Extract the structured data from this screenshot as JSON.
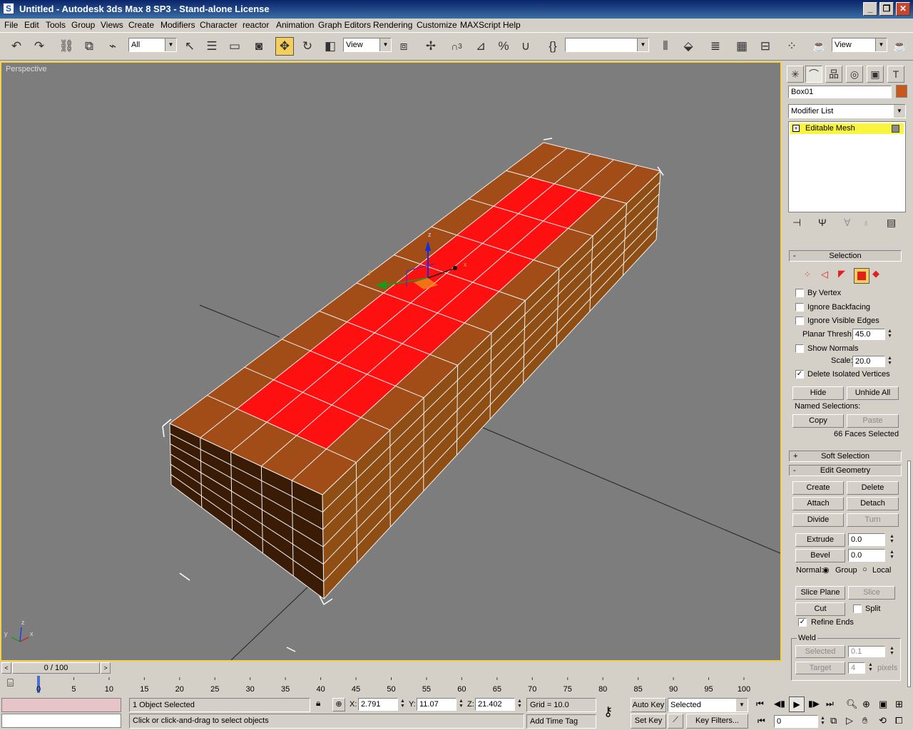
{
  "window": {
    "title": "Untitled - Autodesk 3ds Max 8 SP3  - Stand-alone License"
  },
  "menu": [
    "File",
    "Edit",
    "Tools",
    "Group",
    "Views",
    "Create",
    "Modifiers",
    "Character",
    "reactor",
    "Animation",
    "Graph Editors",
    "Rendering",
    "Customize",
    "MAXScript",
    "Help"
  ],
  "toolbar": {
    "selection_filter": "All",
    "ref_coord": "View",
    "named_sel": "",
    "render_view": "View",
    "snap_angle": "3",
    "snap_percent": "%"
  },
  "viewport": {
    "label": "Perspective",
    "gizmo_axes": {
      "x": "x",
      "y": "y",
      "z": "z"
    },
    "corner_axes": {
      "x": "x",
      "y": "y",
      "z": "z"
    }
  },
  "command_panel": {
    "object_name": "Box01",
    "object_color": "#c8571a",
    "modifier_list": "Modifier List",
    "stack_item": "Editable Mesh",
    "selection": {
      "title": "Selection",
      "by_vertex": "By Vertex",
      "ignore_backfacing": "Ignore Backfacing",
      "ignore_visible_edges": "Ignore Visible Edges",
      "planar_thresh_label": "Planar Thresh:",
      "planar_thresh": "45.0",
      "show_normals": "Show Normals",
      "scale_label": "Scale:",
      "scale": "20.0",
      "delete_isolated": "Delete Isolated Vertices",
      "hide": "Hide",
      "unhide_all": "Unhide All",
      "named_selections": "Named Selections:",
      "copy": "Copy",
      "paste": "Paste",
      "status": "66 Faces Selected"
    },
    "soft_selection": {
      "title": "Soft Selection"
    },
    "edit_geometry": {
      "title": "Edit Geometry",
      "create": "Create",
      "delete": "Delete",
      "attach": "Attach",
      "detach": "Detach",
      "divide": "Divide",
      "turn": "Turn",
      "extrude": "Extrude",
      "extrude_val": "0.0",
      "bevel": "Bevel",
      "bevel_val": "0.0",
      "normal_label": "Normal:",
      "group": "Group",
      "local": "Local",
      "slice_plane": "Slice Plane",
      "slice": "Slice",
      "cut": "Cut",
      "split": "Split",
      "refine_ends": "Refine Ends",
      "weld": "Weld",
      "weld_selected": "Selected",
      "weld_selected_val": "0.1",
      "weld_target": "Target",
      "weld_target_val": "4",
      "pixels": "pixels"
    }
  },
  "timeline": {
    "frame": "0 / 100",
    "ticks": [
      "0",
      "5",
      "10",
      "15",
      "20",
      "25",
      "30",
      "35",
      "40",
      "45",
      "50",
      "55",
      "60",
      "65",
      "70",
      "75",
      "80",
      "85",
      "90",
      "95",
      "100"
    ]
  },
  "status": {
    "selected": "1 Object Selected",
    "prompt": "Click or click-and-drag to select objects",
    "x_label": "X:",
    "x": "2.791",
    "y_label": "Y:",
    "y": "11.07",
    "z_label": "Z:",
    "z": "21.402",
    "grid": "Grid = 10.0",
    "add_time_tag": "Add Time Tag",
    "auto_key": "Auto Key",
    "set_key": "Set Key",
    "key_mode": "Selected",
    "key_filters": "Key Filters...",
    "current_frame": "0"
  }
}
